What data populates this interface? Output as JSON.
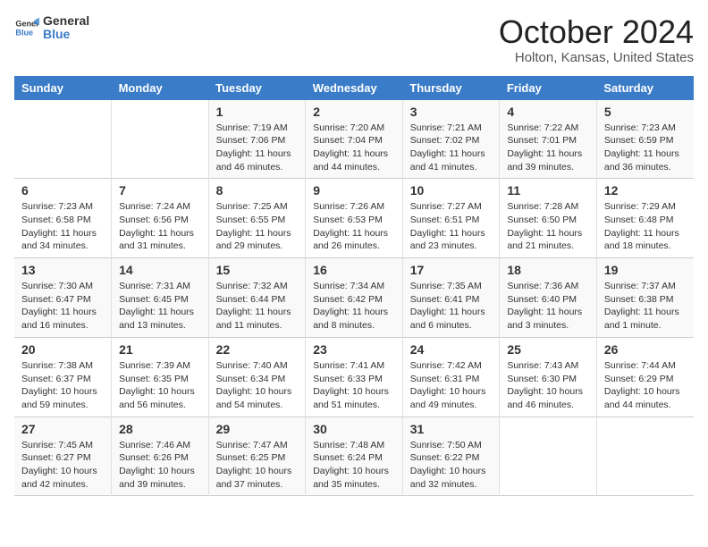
{
  "header": {
    "logo_general": "General",
    "logo_blue": "Blue",
    "title": "October 2024",
    "subtitle": "Holton, Kansas, United States"
  },
  "days_of_week": [
    "Sunday",
    "Monday",
    "Tuesday",
    "Wednesday",
    "Thursday",
    "Friday",
    "Saturday"
  ],
  "weeks": [
    [
      {
        "day": "",
        "sunrise": "",
        "sunset": "",
        "daylight": ""
      },
      {
        "day": "",
        "sunrise": "",
        "sunset": "",
        "daylight": ""
      },
      {
        "day": "1",
        "sunrise": "Sunrise: 7:19 AM",
        "sunset": "Sunset: 7:06 PM",
        "daylight": "Daylight: 11 hours and 46 minutes."
      },
      {
        "day": "2",
        "sunrise": "Sunrise: 7:20 AM",
        "sunset": "Sunset: 7:04 PM",
        "daylight": "Daylight: 11 hours and 44 minutes."
      },
      {
        "day": "3",
        "sunrise": "Sunrise: 7:21 AM",
        "sunset": "Sunset: 7:02 PM",
        "daylight": "Daylight: 11 hours and 41 minutes."
      },
      {
        "day": "4",
        "sunrise": "Sunrise: 7:22 AM",
        "sunset": "Sunset: 7:01 PM",
        "daylight": "Daylight: 11 hours and 39 minutes."
      },
      {
        "day": "5",
        "sunrise": "Sunrise: 7:23 AM",
        "sunset": "Sunset: 6:59 PM",
        "daylight": "Daylight: 11 hours and 36 minutes."
      }
    ],
    [
      {
        "day": "6",
        "sunrise": "Sunrise: 7:23 AM",
        "sunset": "Sunset: 6:58 PM",
        "daylight": "Daylight: 11 hours and 34 minutes."
      },
      {
        "day": "7",
        "sunrise": "Sunrise: 7:24 AM",
        "sunset": "Sunset: 6:56 PM",
        "daylight": "Daylight: 11 hours and 31 minutes."
      },
      {
        "day": "8",
        "sunrise": "Sunrise: 7:25 AM",
        "sunset": "Sunset: 6:55 PM",
        "daylight": "Daylight: 11 hours and 29 minutes."
      },
      {
        "day": "9",
        "sunrise": "Sunrise: 7:26 AM",
        "sunset": "Sunset: 6:53 PM",
        "daylight": "Daylight: 11 hours and 26 minutes."
      },
      {
        "day": "10",
        "sunrise": "Sunrise: 7:27 AM",
        "sunset": "Sunset: 6:51 PM",
        "daylight": "Daylight: 11 hours and 23 minutes."
      },
      {
        "day": "11",
        "sunrise": "Sunrise: 7:28 AM",
        "sunset": "Sunset: 6:50 PM",
        "daylight": "Daylight: 11 hours and 21 minutes."
      },
      {
        "day": "12",
        "sunrise": "Sunrise: 7:29 AM",
        "sunset": "Sunset: 6:48 PM",
        "daylight": "Daylight: 11 hours and 18 minutes."
      }
    ],
    [
      {
        "day": "13",
        "sunrise": "Sunrise: 7:30 AM",
        "sunset": "Sunset: 6:47 PM",
        "daylight": "Daylight: 11 hours and 16 minutes."
      },
      {
        "day": "14",
        "sunrise": "Sunrise: 7:31 AM",
        "sunset": "Sunset: 6:45 PM",
        "daylight": "Daylight: 11 hours and 13 minutes."
      },
      {
        "day": "15",
        "sunrise": "Sunrise: 7:32 AM",
        "sunset": "Sunset: 6:44 PM",
        "daylight": "Daylight: 11 hours and 11 minutes."
      },
      {
        "day": "16",
        "sunrise": "Sunrise: 7:34 AM",
        "sunset": "Sunset: 6:42 PM",
        "daylight": "Daylight: 11 hours and 8 minutes."
      },
      {
        "day": "17",
        "sunrise": "Sunrise: 7:35 AM",
        "sunset": "Sunset: 6:41 PM",
        "daylight": "Daylight: 11 hours and 6 minutes."
      },
      {
        "day": "18",
        "sunrise": "Sunrise: 7:36 AM",
        "sunset": "Sunset: 6:40 PM",
        "daylight": "Daylight: 11 hours and 3 minutes."
      },
      {
        "day": "19",
        "sunrise": "Sunrise: 7:37 AM",
        "sunset": "Sunset: 6:38 PM",
        "daylight": "Daylight: 11 hours and 1 minute."
      }
    ],
    [
      {
        "day": "20",
        "sunrise": "Sunrise: 7:38 AM",
        "sunset": "Sunset: 6:37 PM",
        "daylight": "Daylight: 10 hours and 59 minutes."
      },
      {
        "day": "21",
        "sunrise": "Sunrise: 7:39 AM",
        "sunset": "Sunset: 6:35 PM",
        "daylight": "Daylight: 10 hours and 56 minutes."
      },
      {
        "day": "22",
        "sunrise": "Sunrise: 7:40 AM",
        "sunset": "Sunset: 6:34 PM",
        "daylight": "Daylight: 10 hours and 54 minutes."
      },
      {
        "day": "23",
        "sunrise": "Sunrise: 7:41 AM",
        "sunset": "Sunset: 6:33 PM",
        "daylight": "Daylight: 10 hours and 51 minutes."
      },
      {
        "day": "24",
        "sunrise": "Sunrise: 7:42 AM",
        "sunset": "Sunset: 6:31 PM",
        "daylight": "Daylight: 10 hours and 49 minutes."
      },
      {
        "day": "25",
        "sunrise": "Sunrise: 7:43 AM",
        "sunset": "Sunset: 6:30 PM",
        "daylight": "Daylight: 10 hours and 46 minutes."
      },
      {
        "day": "26",
        "sunrise": "Sunrise: 7:44 AM",
        "sunset": "Sunset: 6:29 PM",
        "daylight": "Daylight: 10 hours and 44 minutes."
      }
    ],
    [
      {
        "day": "27",
        "sunrise": "Sunrise: 7:45 AM",
        "sunset": "Sunset: 6:27 PM",
        "daylight": "Daylight: 10 hours and 42 minutes."
      },
      {
        "day": "28",
        "sunrise": "Sunrise: 7:46 AM",
        "sunset": "Sunset: 6:26 PM",
        "daylight": "Daylight: 10 hours and 39 minutes."
      },
      {
        "day": "29",
        "sunrise": "Sunrise: 7:47 AM",
        "sunset": "Sunset: 6:25 PM",
        "daylight": "Daylight: 10 hours and 37 minutes."
      },
      {
        "day": "30",
        "sunrise": "Sunrise: 7:48 AM",
        "sunset": "Sunset: 6:24 PM",
        "daylight": "Daylight: 10 hours and 35 minutes."
      },
      {
        "day": "31",
        "sunrise": "Sunrise: 7:50 AM",
        "sunset": "Sunset: 6:22 PM",
        "daylight": "Daylight: 10 hours and 32 minutes."
      },
      {
        "day": "",
        "sunrise": "",
        "sunset": "",
        "daylight": ""
      },
      {
        "day": "",
        "sunrise": "",
        "sunset": "",
        "daylight": ""
      }
    ]
  ]
}
